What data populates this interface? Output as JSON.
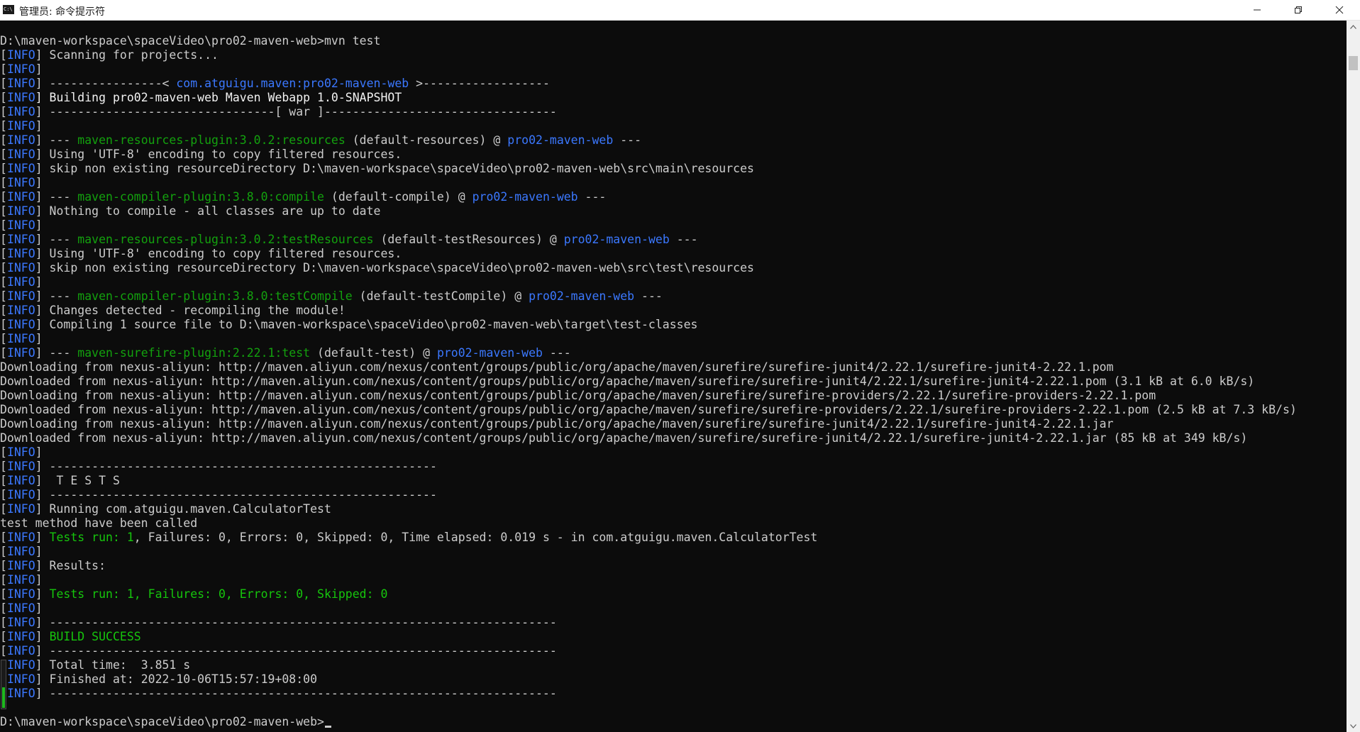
{
  "window": {
    "title": "管理员: 命令提示符",
    "icon_label": "C:\\"
  },
  "controls": {
    "minimize_icon": "minimize-icon",
    "restore_icon": "restore-icon",
    "close_icon": "close-icon"
  },
  "colors": {
    "background": "#0c0c0c",
    "text": "#cccccc",
    "info": "#3b78ff",
    "success": "#16c60c",
    "plugin": "#13a10e"
  },
  "console": {
    "lines": [
      {
        "segs": [
          {
            "t": "D:\\maven-workspace\\spaceVideo\\pro02-maven-web>mvn test",
            "c": "default"
          }
        ]
      },
      {
        "segs": [
          {
            "t": "[",
            "c": "default"
          },
          {
            "t": "INFO",
            "c": "info"
          },
          {
            "t": "] Scanning for projects...",
            "c": "default"
          }
        ]
      },
      {
        "segs": [
          {
            "t": "[",
            "c": "default"
          },
          {
            "t": "INFO",
            "c": "info"
          },
          {
            "t": "]",
            "c": "default"
          }
        ]
      },
      {
        "segs": [
          {
            "t": "[",
            "c": "default"
          },
          {
            "t": "INFO",
            "c": "info"
          },
          {
            "t": "] ----------------< ",
            "c": "default"
          },
          {
            "t": "com.atguigu.maven:pro02-maven-web",
            "c": "cyan"
          },
          {
            "t": " >------------------",
            "c": "default"
          }
        ]
      },
      {
        "segs": [
          {
            "t": "[",
            "c": "default"
          },
          {
            "t": "INFO",
            "c": "info"
          },
          {
            "t": "] Building pro02-maven-web Maven Webapp 1.0-SNAPSHOT",
            "c": "bold"
          }
        ]
      },
      {
        "segs": [
          {
            "t": "[",
            "c": "default"
          },
          {
            "t": "INFO",
            "c": "info"
          },
          {
            "t": "] --------------------------------[ war ]---------------------------------",
            "c": "default"
          }
        ]
      },
      {
        "segs": [
          {
            "t": "[",
            "c": "default"
          },
          {
            "t": "INFO",
            "c": "info"
          },
          {
            "t": "]",
            "c": "default"
          }
        ]
      },
      {
        "segs": [
          {
            "t": "[",
            "c": "default"
          },
          {
            "t": "INFO",
            "c": "info"
          },
          {
            "t": "] --- ",
            "c": "default"
          },
          {
            "t": "maven-resources-plugin:3.0.2:resources",
            "c": "plugin"
          },
          {
            "t": " (default-resources) @ ",
            "c": "default"
          },
          {
            "t": "pro02-maven-web",
            "c": "cyan"
          },
          {
            "t": " ---",
            "c": "default"
          }
        ]
      },
      {
        "segs": [
          {
            "t": "[",
            "c": "default"
          },
          {
            "t": "INFO",
            "c": "info"
          },
          {
            "t": "] Using 'UTF-8' encoding to copy filtered resources.",
            "c": "default"
          }
        ]
      },
      {
        "segs": [
          {
            "t": "[",
            "c": "default"
          },
          {
            "t": "INFO",
            "c": "info"
          },
          {
            "t": "] skip non existing resourceDirectory D:\\maven-workspace\\spaceVideo\\pro02-maven-web\\src\\main\\resources",
            "c": "default"
          }
        ]
      },
      {
        "segs": [
          {
            "t": "[",
            "c": "default"
          },
          {
            "t": "INFO",
            "c": "info"
          },
          {
            "t": "]",
            "c": "default"
          }
        ]
      },
      {
        "segs": [
          {
            "t": "[",
            "c": "default"
          },
          {
            "t": "INFO",
            "c": "info"
          },
          {
            "t": "] --- ",
            "c": "default"
          },
          {
            "t": "maven-compiler-plugin:3.8.0:compile",
            "c": "plugin"
          },
          {
            "t": " (default-compile) @ ",
            "c": "default"
          },
          {
            "t": "pro02-maven-web",
            "c": "cyan"
          },
          {
            "t": " ---",
            "c": "default"
          }
        ]
      },
      {
        "segs": [
          {
            "t": "[",
            "c": "default"
          },
          {
            "t": "INFO",
            "c": "info"
          },
          {
            "t": "] Nothing to compile - all classes are up to date",
            "c": "default"
          }
        ]
      },
      {
        "segs": [
          {
            "t": "[",
            "c": "default"
          },
          {
            "t": "INFO",
            "c": "info"
          },
          {
            "t": "]",
            "c": "default"
          }
        ]
      },
      {
        "segs": [
          {
            "t": "[",
            "c": "default"
          },
          {
            "t": "INFO",
            "c": "info"
          },
          {
            "t": "] --- ",
            "c": "default"
          },
          {
            "t": "maven-resources-plugin:3.0.2:testResources",
            "c": "plugin"
          },
          {
            "t": " (default-testResources) @ ",
            "c": "default"
          },
          {
            "t": "pro02-maven-web",
            "c": "cyan"
          },
          {
            "t": " ---",
            "c": "default"
          }
        ]
      },
      {
        "segs": [
          {
            "t": "[",
            "c": "default"
          },
          {
            "t": "INFO",
            "c": "info"
          },
          {
            "t": "] Using 'UTF-8' encoding to copy filtered resources.",
            "c": "default"
          }
        ]
      },
      {
        "segs": [
          {
            "t": "[",
            "c": "default"
          },
          {
            "t": "INFO",
            "c": "info"
          },
          {
            "t": "] skip non existing resourceDirectory D:\\maven-workspace\\spaceVideo\\pro02-maven-web\\src\\test\\resources",
            "c": "default"
          }
        ]
      },
      {
        "segs": [
          {
            "t": "[",
            "c": "default"
          },
          {
            "t": "INFO",
            "c": "info"
          },
          {
            "t": "]",
            "c": "default"
          }
        ]
      },
      {
        "segs": [
          {
            "t": "[",
            "c": "default"
          },
          {
            "t": "INFO",
            "c": "info"
          },
          {
            "t": "] --- ",
            "c": "default"
          },
          {
            "t": "maven-compiler-plugin:3.8.0:testCompile",
            "c": "plugin"
          },
          {
            "t": " (default-testCompile) @ ",
            "c": "default"
          },
          {
            "t": "pro02-maven-web",
            "c": "cyan"
          },
          {
            "t": " ---",
            "c": "default"
          }
        ]
      },
      {
        "segs": [
          {
            "t": "[",
            "c": "default"
          },
          {
            "t": "INFO",
            "c": "info"
          },
          {
            "t": "] Changes detected - recompiling the module!",
            "c": "default"
          }
        ]
      },
      {
        "segs": [
          {
            "t": "[",
            "c": "default"
          },
          {
            "t": "INFO",
            "c": "info"
          },
          {
            "t": "] Compiling 1 source file to D:\\maven-workspace\\spaceVideo\\pro02-maven-web\\target\\test-classes",
            "c": "default"
          }
        ]
      },
      {
        "segs": [
          {
            "t": "[",
            "c": "default"
          },
          {
            "t": "INFO",
            "c": "info"
          },
          {
            "t": "]",
            "c": "default"
          }
        ]
      },
      {
        "segs": [
          {
            "t": "[",
            "c": "default"
          },
          {
            "t": "INFO",
            "c": "info"
          },
          {
            "t": "] --- ",
            "c": "default"
          },
          {
            "t": "maven-surefire-plugin:2.22.1:test",
            "c": "plugin"
          },
          {
            "t": " (default-test) @ ",
            "c": "default"
          },
          {
            "t": "pro02-maven-web",
            "c": "cyan"
          },
          {
            "t": " ---",
            "c": "default"
          }
        ]
      },
      {
        "segs": [
          {
            "t": "Downloading from nexus-aliyun: http://maven.aliyun.com/nexus/content/groups/public/org/apache/maven/surefire/surefire-junit4/2.22.1/surefire-junit4-2.22.1.pom",
            "c": "default"
          }
        ]
      },
      {
        "segs": [
          {
            "t": "Downloaded from nexus-aliyun: http://maven.aliyun.com/nexus/content/groups/public/org/apache/maven/surefire/surefire-junit4/2.22.1/surefire-junit4-2.22.1.pom (3.1 kB at 6.0 kB/s)",
            "c": "default"
          }
        ]
      },
      {
        "segs": [
          {
            "t": "Downloading from nexus-aliyun: http://maven.aliyun.com/nexus/content/groups/public/org/apache/maven/surefire/surefire-providers/2.22.1/surefire-providers-2.22.1.pom",
            "c": "default"
          }
        ]
      },
      {
        "segs": [
          {
            "t": "Downloaded from nexus-aliyun: http://maven.aliyun.com/nexus/content/groups/public/org/apache/maven/surefire/surefire-providers/2.22.1/surefire-providers-2.22.1.pom (2.5 kB at 7.3 kB/s)",
            "c": "default"
          }
        ]
      },
      {
        "segs": [
          {
            "t": "Downloading from nexus-aliyun: http://maven.aliyun.com/nexus/content/groups/public/org/apache/maven/surefire/surefire-junit4/2.22.1/surefire-junit4-2.22.1.jar",
            "c": "default"
          }
        ]
      },
      {
        "segs": [
          {
            "t": "Downloaded from nexus-aliyun: http://maven.aliyun.com/nexus/content/groups/public/org/apache/maven/surefire/surefire-junit4/2.22.1/surefire-junit4-2.22.1.jar (85 kB at 349 kB/s)",
            "c": "default"
          }
        ]
      },
      {
        "segs": [
          {
            "t": "[",
            "c": "default"
          },
          {
            "t": "INFO",
            "c": "info"
          },
          {
            "t": "]",
            "c": "default"
          }
        ]
      },
      {
        "segs": [
          {
            "t": "[",
            "c": "default"
          },
          {
            "t": "INFO",
            "c": "info"
          },
          {
            "t": "] -------------------------------------------------------",
            "c": "default"
          }
        ]
      },
      {
        "segs": [
          {
            "t": "[",
            "c": "default"
          },
          {
            "t": "INFO",
            "c": "info"
          },
          {
            "t": "]  T E S T S",
            "c": "default"
          }
        ]
      },
      {
        "segs": [
          {
            "t": "[",
            "c": "default"
          },
          {
            "t": "INFO",
            "c": "info"
          },
          {
            "t": "] -------------------------------------------------------",
            "c": "default"
          }
        ]
      },
      {
        "segs": [
          {
            "t": "[",
            "c": "default"
          },
          {
            "t": "INFO",
            "c": "info"
          },
          {
            "t": "] Running com.atguigu.maven.CalculatorTest",
            "c": "default"
          }
        ]
      },
      {
        "segs": [
          {
            "t": "test method have been called",
            "c": "default"
          }
        ]
      },
      {
        "segs": [
          {
            "t": "[",
            "c": "default"
          },
          {
            "t": "INFO",
            "c": "info"
          },
          {
            "t": "] ",
            "c": "default"
          },
          {
            "t": "Tests run: 1",
            "c": "green"
          },
          {
            "t": ", Failures: 0, Errors: 0, Skipped: 0, Time elapsed: 0.019 s - in com.atguigu.maven.CalculatorTest",
            "c": "default"
          }
        ]
      },
      {
        "segs": [
          {
            "t": "[",
            "c": "default"
          },
          {
            "t": "INFO",
            "c": "info"
          },
          {
            "t": "]",
            "c": "default"
          }
        ]
      },
      {
        "segs": [
          {
            "t": "[",
            "c": "default"
          },
          {
            "t": "INFO",
            "c": "info"
          },
          {
            "t": "] Results:",
            "c": "default"
          }
        ]
      },
      {
        "segs": [
          {
            "t": "[",
            "c": "default"
          },
          {
            "t": "INFO",
            "c": "info"
          },
          {
            "t": "]",
            "c": "default"
          }
        ]
      },
      {
        "segs": [
          {
            "t": "[",
            "c": "default"
          },
          {
            "t": "INFO",
            "c": "info"
          },
          {
            "t": "] ",
            "c": "default"
          },
          {
            "t": "Tests run: 1, Failures: 0, Errors: 0, Skipped: 0",
            "c": "green"
          }
        ]
      },
      {
        "segs": [
          {
            "t": "[",
            "c": "default"
          },
          {
            "t": "INFO",
            "c": "info"
          },
          {
            "t": "]",
            "c": "default"
          }
        ]
      },
      {
        "segs": [
          {
            "t": "[",
            "c": "default"
          },
          {
            "t": "INFO",
            "c": "info"
          },
          {
            "t": "] ------------------------------------------------------------------------",
            "c": "default"
          }
        ]
      },
      {
        "segs": [
          {
            "t": "[",
            "c": "default"
          },
          {
            "t": "INFO",
            "c": "info"
          },
          {
            "t": "] ",
            "c": "default"
          },
          {
            "t": "BUILD SUCCESS",
            "c": "green"
          }
        ]
      },
      {
        "segs": [
          {
            "t": "[",
            "c": "default"
          },
          {
            "t": "INFO",
            "c": "info"
          },
          {
            "t": "] ------------------------------------------------------------------------",
            "c": "default"
          }
        ]
      },
      {
        "segs": [
          {
            "t": "[",
            "c": "default"
          },
          {
            "t": "INFO",
            "c": "info"
          },
          {
            "t": "] Total time:  3.851 s",
            "c": "default"
          }
        ]
      },
      {
        "segs": [
          {
            "t": "[",
            "c": "default"
          },
          {
            "t": "INFO",
            "c": "info"
          },
          {
            "t": "] Finished at: 2022-10-06T15:57:19+08:00",
            "c": "default"
          }
        ]
      },
      {
        "segs": [
          {
            "t": "[",
            "c": "default"
          },
          {
            "t": "INFO",
            "c": "info"
          },
          {
            "t": "] ------------------------------------------------------------------------",
            "c": "default"
          }
        ]
      },
      {
        "segs": []
      },
      {
        "segs": [
          {
            "t": "D:\\maven-workspace\\spaceVideo\\pro02-maven-web>",
            "c": "default"
          }
        ]
      }
    ]
  },
  "progress": {
    "fraction": 0.45,
    "color": "#1fb81f"
  },
  "scrollbar": {
    "up_icon": "scroll-up-arrow-icon",
    "down_icon": "scroll-down-arrow-icon"
  }
}
